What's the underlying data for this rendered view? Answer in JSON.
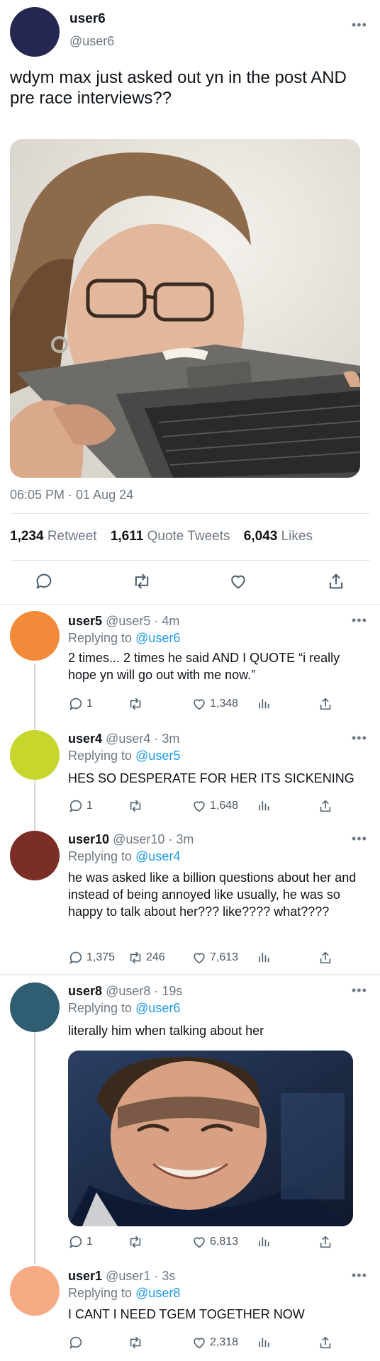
{
  "main_tweet": {
    "name": "user6",
    "handle": "@user6",
    "text": "wdym max just asked out yn in the post AND pre race interviews??",
    "timestamp": "06:05 PM · 01 Aug 24",
    "stats": {
      "retweets_count": "1,234",
      "retweets_label": "Retweet",
      "quotes_count": "1,611",
      "quotes_label": "Quote Tweets",
      "likes_count": "6,043",
      "likes_label": "Likes"
    },
    "avatar_color": "#262652"
  },
  "replies": [
    {
      "name": "user5",
      "handle_time": "@user5 · 4m",
      "replying_prefix": "Replying to",
      "replying_to": "@user6",
      "text": "2 times... 2 times he said AND I QUOTE “i really hope yn will go out with me now.”",
      "replies": "1",
      "retweets": "",
      "likes": "1,348",
      "avatar_color": "#f28a3a"
    },
    {
      "name": "user4",
      "handle_time": "@user4 · 3m",
      "replying_prefix": "Replying to",
      "replying_to": "@user5",
      "text": "HES SO DESPERATE FOR HER ITS SICKENING",
      "replies": "1",
      "retweets": "",
      "likes": "1,648",
      "avatar_color": "#c6d62c"
    },
    {
      "name": "user10",
      "handle_time": "@user10 · 3m",
      "replying_prefix": "Replying to",
      "replying_to": "@user4",
      "text": "he was asked like a billion questions about her and instead of being annoyed like usually, he was so happy to talk about her??? like???? what????",
      "replies": "1,375",
      "retweets": "246",
      "likes": "7,613",
      "avatar_color": "#7a2e26"
    },
    {
      "name": "user8",
      "handle_time": "@user8 · 19s",
      "replying_prefix": "Replying to",
      "replying_to": "@user6",
      "text": "literally him when talking about her",
      "replies": "1",
      "retweets": "",
      "likes": "6,813",
      "avatar_color": "#2f5e72"
    },
    {
      "name": "user1",
      "handle_time": "@user1 · 3s",
      "replying_prefix": "Replying to",
      "replying_to": "@user8",
      "text": "I CANT I NEED TGEM TOGETHER NOW",
      "replies": "",
      "retweets": "",
      "likes": "2,318",
      "avatar_color": "#f7ab84"
    }
  ],
  "icons": {
    "reply": "reply-icon",
    "retweet": "retweet-icon",
    "like": "heart-icon",
    "share": "share-icon",
    "views": "views-icon",
    "more": "more-icon"
  },
  "colors": {
    "link": "#1d9bf0",
    "muted": "#6f7a84",
    "divider": "#e3e6ea"
  }
}
